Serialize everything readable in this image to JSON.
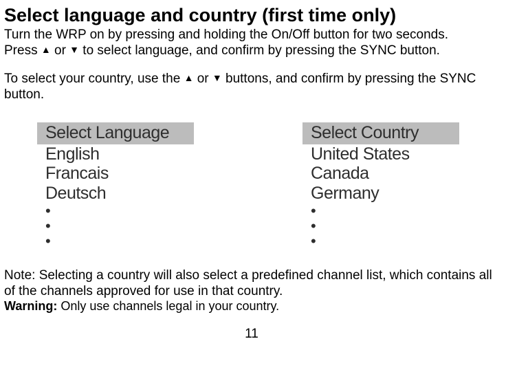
{
  "heading": "Select language and country (first time only)",
  "intro_line1": "Turn the WRP on by pressing and holding the On/Off button for two seconds.",
  "intro_line2_a": "Press ",
  "intro_line2_b": " or ",
  "intro_line2_c": " to select language, and confirm by pressing the SYNC button.",
  "intro_line3_a": "To select your country, use the ",
  "intro_line3_b": " or ",
  "intro_line3_c": " buttons, and confirm by pressing the SYNC button.",
  "menus": {
    "left": {
      "header": "Select Language",
      "items": [
        "English",
        "Francais",
        "Deutsch"
      ]
    },
    "right": {
      "header": "Select Country",
      "items": [
        "United States",
        "Canada",
        "Germany"
      ]
    }
  },
  "note": "Note: Selecting a country will also select a predefined channel list, which contains all of the channels approved for use in that country.",
  "warning_label": "Warning:",
  "warning_text": " Only use channels legal in your country.",
  "page_number": "11",
  "glyphs": {
    "up": "▲",
    "down": "▼",
    "bullet": "•"
  }
}
